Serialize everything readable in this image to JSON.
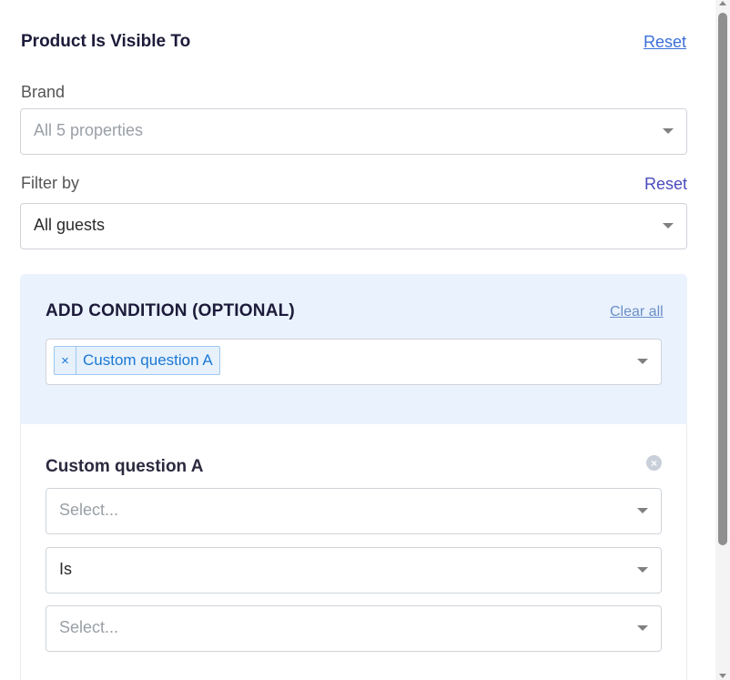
{
  "section": {
    "title": "Product Is Visible To",
    "reset_label": "Reset"
  },
  "brand": {
    "label": "Brand",
    "placeholder": "All 5 properties"
  },
  "filter": {
    "label": "Filter by",
    "reset_label": "Reset",
    "value": "All guests"
  },
  "conditions": {
    "title": "ADD CONDITION (OPTIONAL)",
    "clear_all_label": "Clear all",
    "tags": [
      {
        "remove_symbol": "×",
        "label": "Custom question A"
      }
    ]
  },
  "custom_question": {
    "title": "Custom question A",
    "remove_symbol": "×",
    "question_placeholder": "Select...",
    "operator_value": "Is",
    "answer_placeholder": "Select..."
  },
  "icons": {
    "dropdown": "chevron-down-icon",
    "remove": "close-circle-icon"
  },
  "colors": {
    "link": "#3b6fd9",
    "condition_bg": "#eaf2fd",
    "tag_text": "#1b78d4"
  }
}
